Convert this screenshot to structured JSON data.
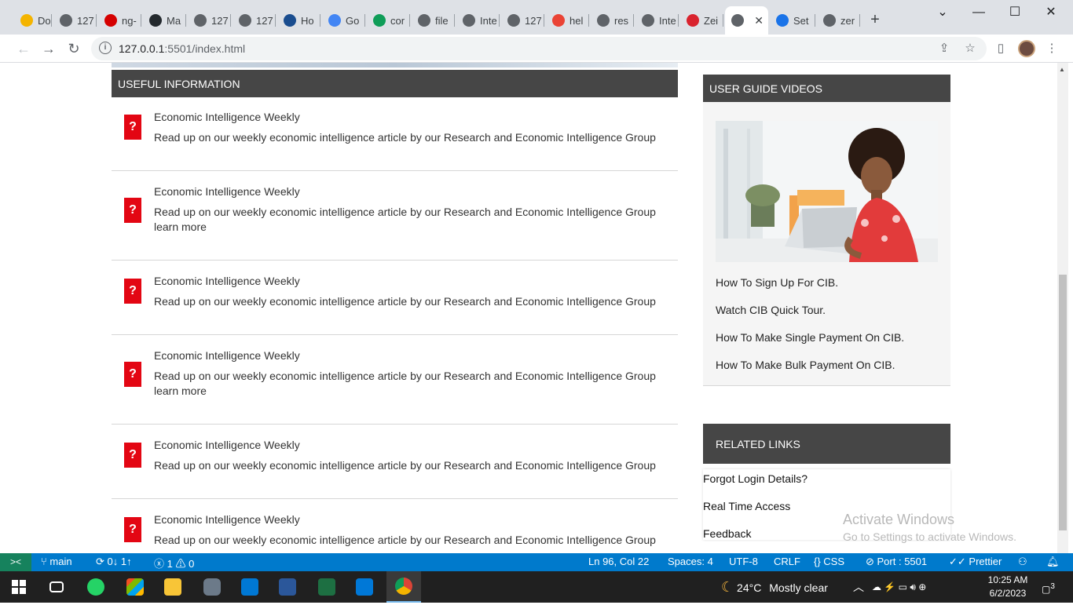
{
  "browser": {
    "tabs": [
      {
        "label": "Do",
        "icon": "doc-icon",
        "color": "#f4b400"
      },
      {
        "label": "127",
        "icon": "globe-icon",
        "color": "#5f6368"
      },
      {
        "label": "ng-",
        "icon": "d-icon",
        "color": "#d50000"
      },
      {
        "label": "Ma",
        "icon": "github-icon",
        "color": "#24292e"
      },
      {
        "label": "127",
        "icon": "globe-icon",
        "color": "#5f6368"
      },
      {
        "label": "127",
        "icon": "globe-icon",
        "color": "#5f6368"
      },
      {
        "label": "Ho",
        "icon": "bank-icon",
        "color": "#1a4d8f"
      },
      {
        "label": "Go",
        "icon": "google-icon",
        "color": "#4285f4"
      },
      {
        "label": "cor",
        "icon": "sheets-icon",
        "color": "#0f9d58"
      },
      {
        "label": "file",
        "icon": "globe-icon",
        "color": "#5f6368"
      },
      {
        "label": "Inte",
        "icon": "link-icon",
        "color": "#5f6368"
      },
      {
        "label": "127",
        "icon": "globe-icon",
        "color": "#5f6368"
      },
      {
        "label": "hel",
        "icon": "gmail-icon",
        "color": "#ea4335"
      },
      {
        "label": "res",
        "icon": "globe-icon",
        "color": "#5f6368"
      },
      {
        "label": "Inte",
        "icon": "link-icon",
        "color": "#5f6368"
      },
      {
        "label": "Zei",
        "icon": "zeplin-icon",
        "color": "#d9232e"
      },
      {
        "label": "",
        "icon": "globe-icon",
        "color": "#5f6368",
        "active": true
      },
      {
        "label": "Set",
        "icon": "settings-gear-icon",
        "color": "#1a73e8"
      },
      {
        "label": "zer",
        "icon": "globe-icon",
        "color": "#5f6368"
      }
    ],
    "new_tab": "+",
    "close_glyph": "✕",
    "url_host": "127.0.0.1",
    "url_rest": ":5501/index.html"
  },
  "useful": {
    "heading": "USEFUL INFORMATION",
    "icon_glyph": "?",
    "items": [
      {
        "title": "Economic Intelligence Weekly",
        "desc": "Read up on our weekly economic intelligence article by our Research and Economic Intelligence Group"
      },
      {
        "title": "Economic Intelligence Weekly",
        "desc": "Read up on our weekly economic intelligence article by our Research and Economic Intelligence Group",
        "more": "learn more"
      },
      {
        "title": "Economic Intelligence Weekly",
        "desc": "Read up on our weekly economic intelligence article by our Research and Economic Intelligence Group"
      },
      {
        "title": "Economic Intelligence Weekly",
        "desc": "Read up on our weekly economic intelligence article by our Research and Economic Intelligence Group",
        "more": "learn more"
      },
      {
        "title": "Economic Intelligence Weekly",
        "desc": "Read up on our weekly economic intelligence article by our Research and Economic Intelligence Group"
      },
      {
        "title": "Economic Intelligence Weekly",
        "desc": "Read up on our weekly economic intelligence article by our Research and Economic Intelligence Group"
      }
    ]
  },
  "guide": {
    "heading": "USER GUIDE VIDEOS",
    "links": [
      "How To Sign Up For CIB.",
      "Watch CIB Quick Tour.",
      "How To Make Single Payment On CIB.",
      "How To Make Bulk Payment On CIB."
    ]
  },
  "related": {
    "heading": "RELATED LINKS",
    "links": [
      "Forgot Login Details?",
      "Real Time Access",
      "Feedback"
    ]
  },
  "watermark": {
    "line1": "Activate Windows",
    "line2": "Go to Settings to activate Windows."
  },
  "statusbar": {
    "remote": "><",
    "branch": "main",
    "sync": "0↓ 1↑",
    "problems": "ⓧ 1 ⚠ 0",
    "position": "Ln 96, Col 22",
    "spaces": "Spaces: 4",
    "encoding": "UTF-8",
    "eol": "CRLF",
    "language": "CSS",
    "port": "Port : 5501",
    "prettier": "Prettier"
  },
  "taskbar": {
    "weather_temp": "24°C",
    "weather_text": "Mostly clear",
    "time": "10:25 AM",
    "date": "6/2/2023",
    "notifications": "3"
  },
  "colors": {
    "header_bg": "#464646",
    "icon_red": "#e30613",
    "statusbar_blue": "#007acc"
  }
}
